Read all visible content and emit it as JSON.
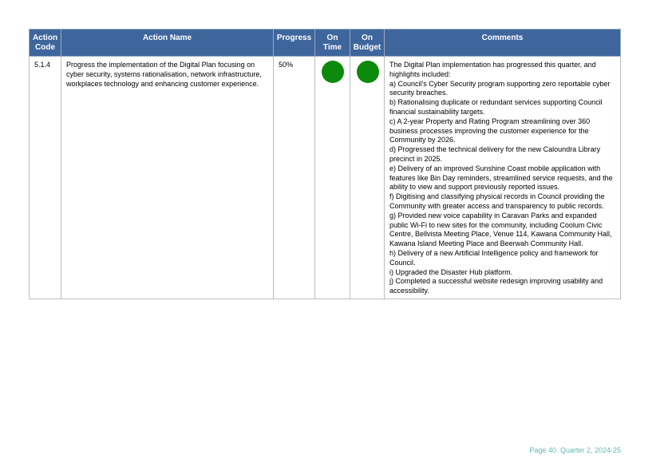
{
  "table": {
    "headers": {
      "code": "Action Code",
      "name": "Action Name",
      "progress": "Progress",
      "on_time": "On Time",
      "on_budget": "On Budget",
      "comments": "Comments"
    },
    "row": {
      "code": "5.1.4",
      "name": "Progress the implementation of the Digital Plan focusing on cyber security, systems rationalisation, network infrastructure, workplaces technology and enhancing customer experience.",
      "progress": "50%",
      "on_time_status": "green",
      "on_budget_status": "green",
      "comments": [
        "The Digital Plan implementation has progressed this quarter, and highlights included:",
        "a) Council's Cyber Security program supporting zero reportable cyber security breaches.",
        "b) Rationalising duplicate or redundant services supporting Council financial sustainability targets.",
        "c) A 2-year Property and Rating Program streamlining over 360 business processes improving the customer experience for the Community by 2026.",
        "d) Progressed the technical delivery for the new Caloundra Library precinct in 2025.",
        "e) Delivery of an improved Sunshine Coast mobile application with features like Bin Day reminders, streamlined service requests, and the ability to view and support previously reported issues.",
        "f) Digitising and classifying physical records in Council providing the Community with greater access and transparency to public records.",
        "g) Provided new voice capability in Caravan Parks and expanded public Wi-Fi to new sites for the community, including Coolum Civic Centre, Bellvista Meeting Place, Venue 114, Kawana Community Hall, Kawana Island Meeting Place and Beerwah Community Hall.",
        "h) Delivery of a new Artificial Intelligence policy and framework for Council.",
        "i) Upgraded the Disaster Hub platform.",
        "j) Completed a successful website redesign improving usability and accessibility."
      ]
    }
  },
  "footer": {
    "page_label": "Page 40. Quarter 2, 2024-25"
  },
  "colors": {
    "header_bg": "#3e669d",
    "status_green": "#0b8a0b",
    "footer_text": "#5fb8b6"
  }
}
